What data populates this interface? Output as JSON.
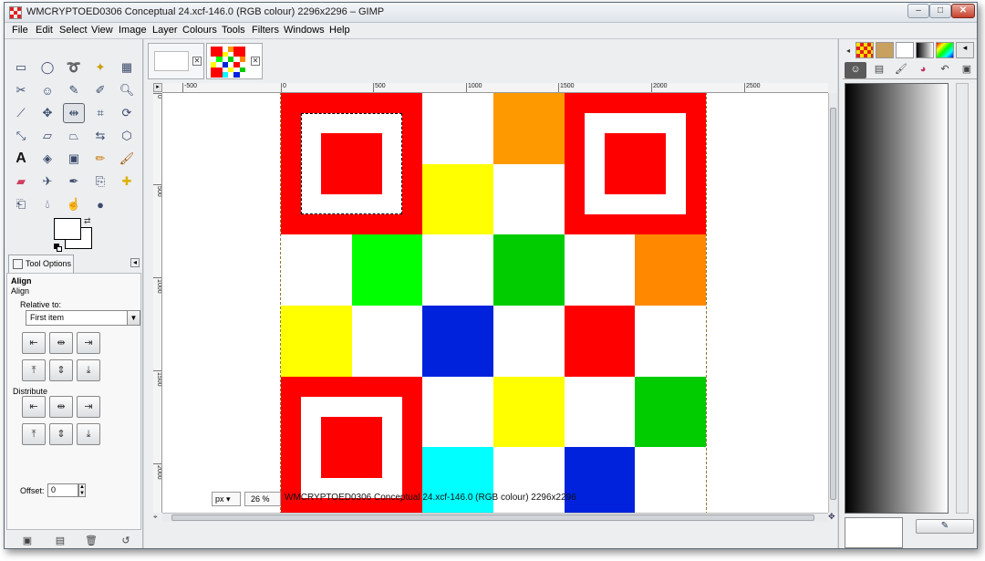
{
  "window": {
    "title": "WMCRYPTOED0306 Conceptual 24.xcf-146.0 (RGB colour) 2296x2296 – GIMP",
    "minimize": "–",
    "maximize": "□",
    "close": "✕"
  },
  "menu": [
    "File",
    "Edit",
    "Select",
    "View",
    "Image",
    "Layer",
    "Colours",
    "Tools",
    "Filters",
    "Windows",
    "Help"
  ],
  "toolbox": {
    "tools": [
      "rect-select",
      "ellipse-select",
      "free-select",
      "fuzzy-select",
      "by-color-select",
      "scissors-select",
      "foreground-select",
      "paths",
      "color-picker",
      "zoom",
      "measure",
      "move",
      "align",
      "crop",
      "rotate",
      "scale",
      "shear",
      "perspective",
      "flip",
      "cage-transform",
      "text",
      "bucket-fill",
      "blend",
      "pencil",
      "paintbrush",
      "eraser",
      "airbrush",
      "ink",
      "clone",
      "heal",
      "perspective-clone",
      "blur-sharpen",
      "smudge",
      "dodge-burn"
    ],
    "tool_options_tab": "Tool Options",
    "panel_title": "Align",
    "panel_subtitle": "Align",
    "relative_to_label": "Relative to:",
    "relative_to_value": "First item",
    "distribute_label": "Distribute",
    "offset_label": "Offset:",
    "offset_value": "0"
  },
  "rulers": {
    "h": [
      "-500",
      "0",
      "500",
      "1000",
      "1500",
      "2000",
      "2500"
    ],
    "v": [
      "0",
      "500",
      "1000",
      "1500",
      "2000"
    ]
  },
  "qr_colors": {
    "red": "#ff0000",
    "white": "#ffffff",
    "orange": "#ff9900",
    "dark_orange": "#ff8800",
    "yellow": "#ffff00",
    "green": "#00ff00",
    "dark_green": "#00cc00",
    "blue": "#0022dd",
    "cyan": "#00ffff"
  },
  "qr_grid": [
    [
      "red",
      "red",
      "white",
      "orange",
      "red",
      "red"
    ],
    [
      "red",
      "red",
      "yellow",
      "white",
      "red",
      "red"
    ],
    [
      "white",
      "green",
      "white",
      "dark_green",
      "white",
      "dark_orange"
    ],
    [
      "yellow",
      "white",
      "blue",
      "white",
      "red",
      "white"
    ],
    [
      "red",
      "red",
      "white",
      "yellow",
      "white",
      "dark_green"
    ],
    [
      "red",
      "red",
      "cyan",
      "white",
      "blue",
      "white"
    ]
  ],
  "statusbar": {
    "unit": "px",
    "zoom": "26 %",
    "text": "WMCRYPTOED0306 Conceptual 24.xcf-146.0 (RGB colour) 2296x2296"
  }
}
